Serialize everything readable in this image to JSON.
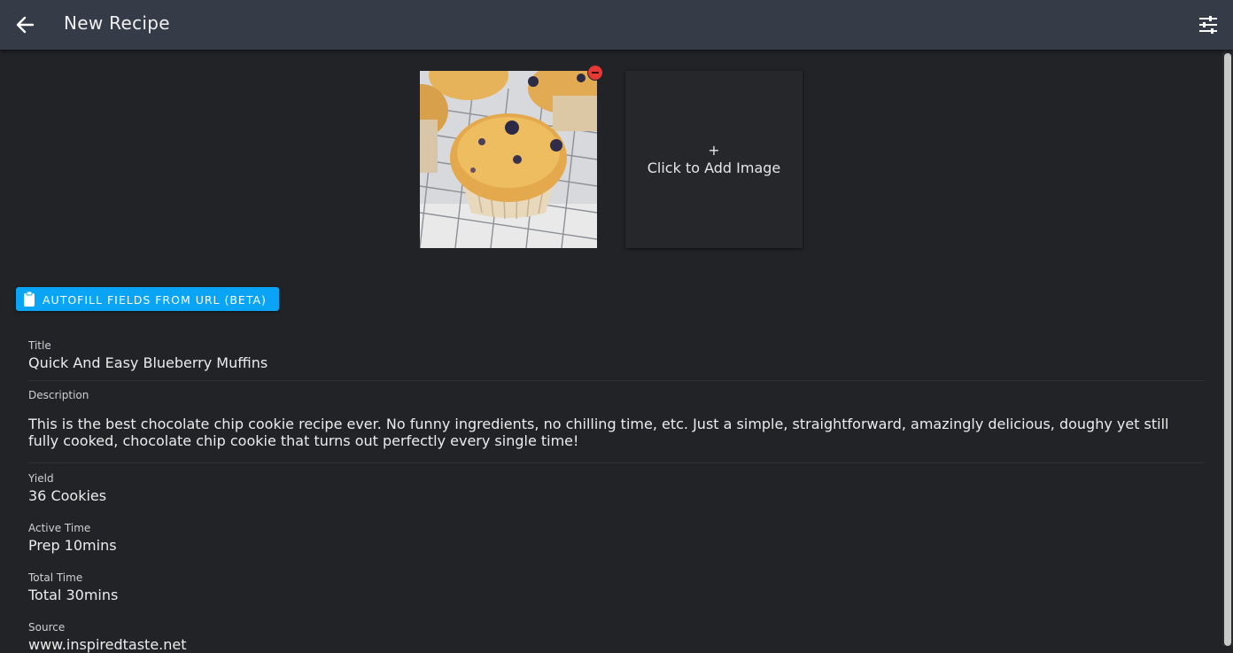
{
  "header": {
    "title": "New Recipe",
    "back_icon": "arrow-left-icon",
    "settings_icon": "tune-sliders-icon"
  },
  "images": {
    "add_plus": "+",
    "add_label": "Click to Add Image"
  },
  "autofill": {
    "label": "AUTOFILL FIELDS FROM URL (BETA)",
    "icon": "clipboard-icon"
  },
  "fields": {
    "title": {
      "label": "Title",
      "value": "Quick And Easy Blueberry Muffins"
    },
    "description": {
      "label": "Description",
      "line1": "This is the best chocolate chip cookie recipe ever. No funny ingredients, no chilling time, etc. Just a simple, straightforward, amazingly delicious, doughy yet still",
      "line2": "fully cooked, chocolate chip cookie that turns out perfectly every single time!"
    },
    "yield": {
      "label": "Yield",
      "value": "36 Cookies"
    },
    "active_time": {
      "label": "Active Time",
      "value": "Prep 10mins"
    },
    "total_time": {
      "label": "Total Time",
      "value": "Total 30mins"
    },
    "source": {
      "label": "Source",
      "value": "www.inspiredtaste.net"
    }
  },
  "colors": {
    "background": "#222327",
    "topbar": "#363b48",
    "accent": "#0aa4f6",
    "remove": "#e53935"
  }
}
